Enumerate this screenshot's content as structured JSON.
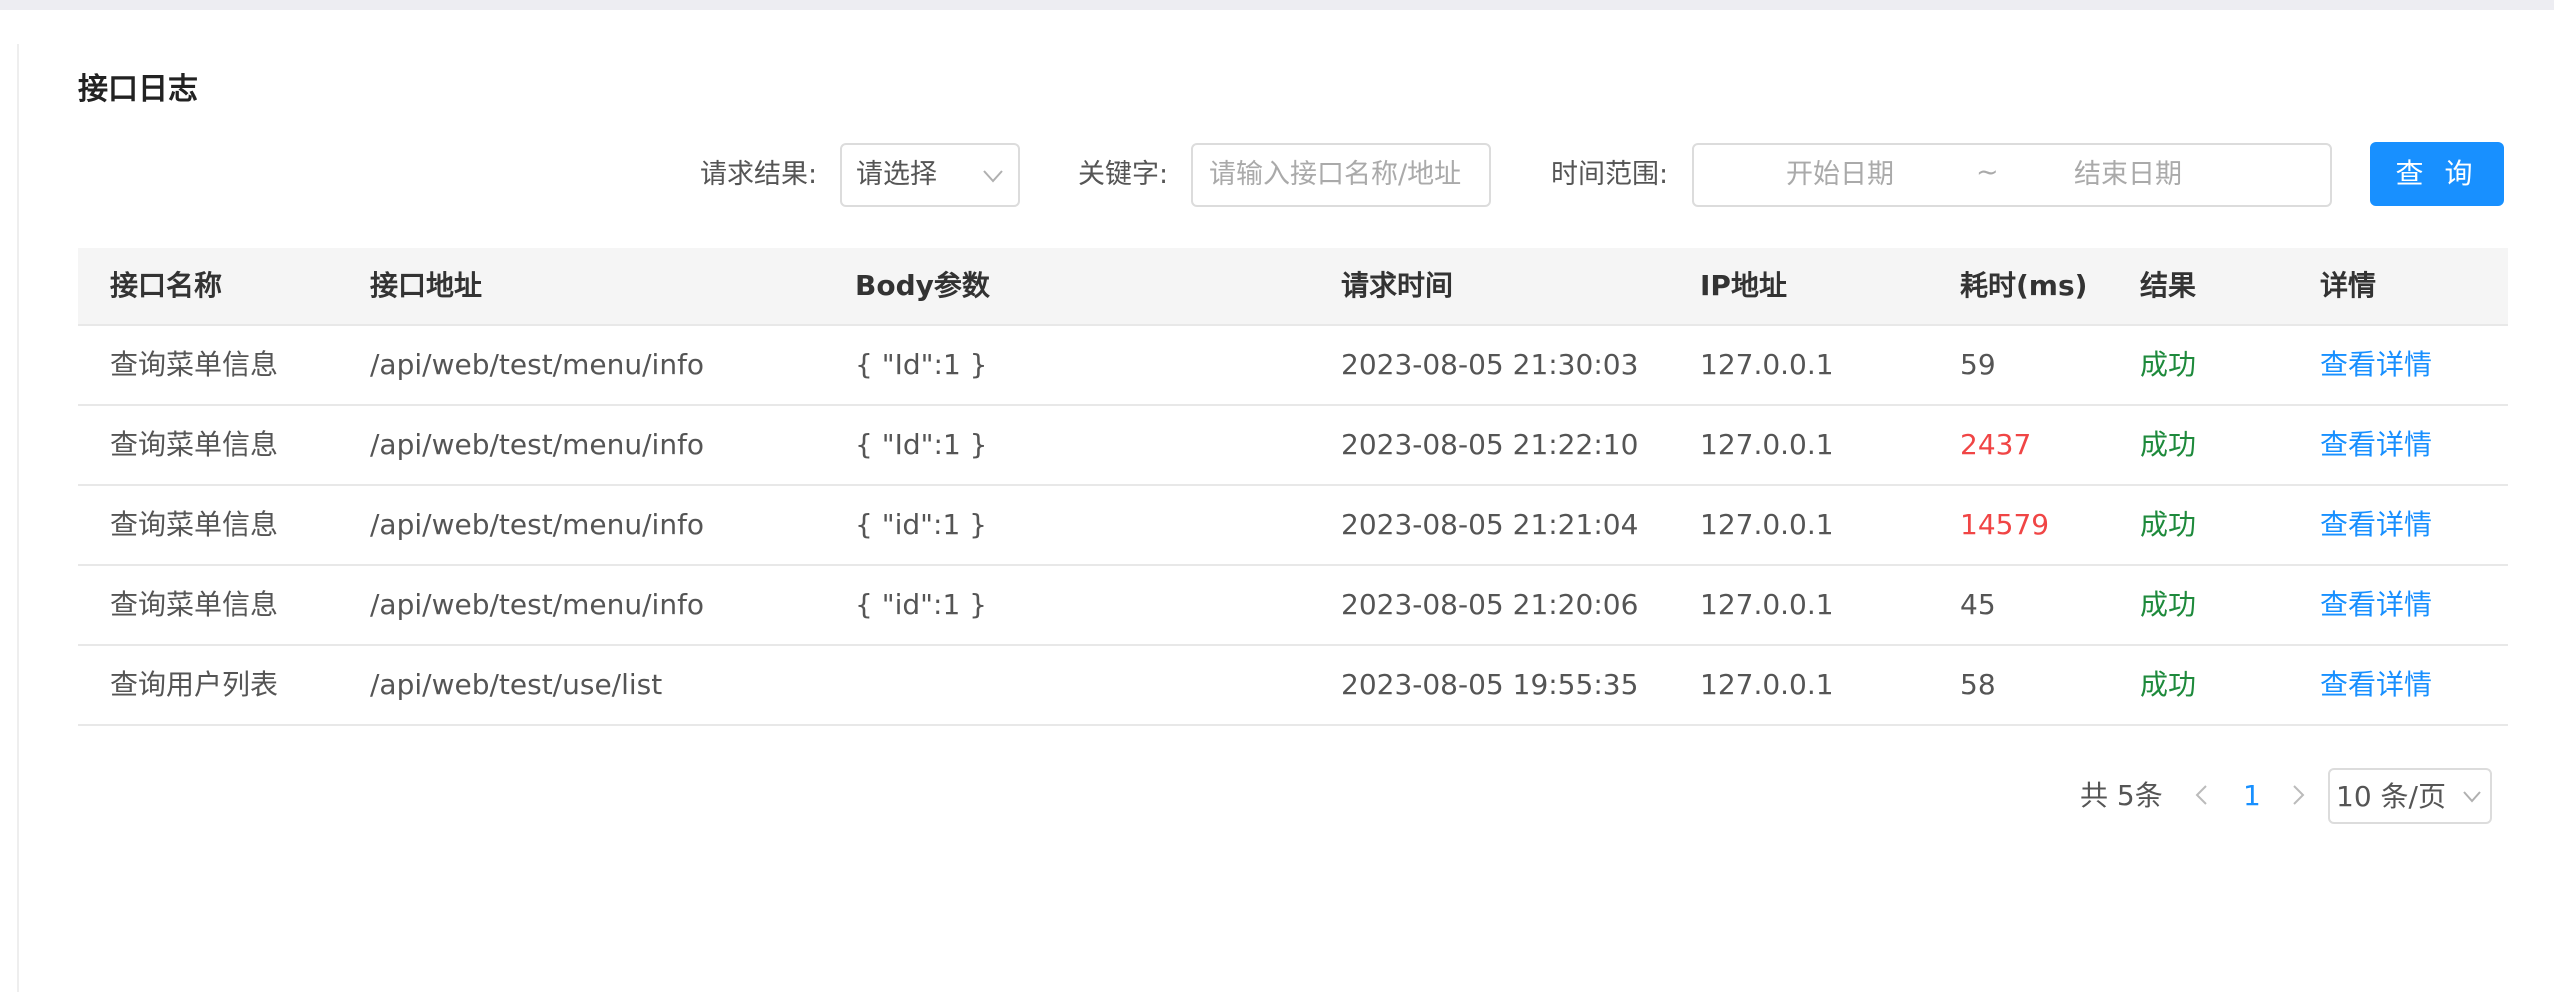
{
  "title": "接口日志",
  "filters": {
    "result_label": "请求结果:",
    "result_value": "请选择",
    "keyword_label": "关键字:",
    "keyword_placeholder": "请输入接口名称/地址",
    "time_label": "时间范围:",
    "start_placeholder": "开始日期",
    "range_sep": "~",
    "end_placeholder": "结束日期",
    "query_button": "查 询"
  },
  "table": {
    "columns": [
      "接口名称",
      "接口地址",
      "Body参数",
      "请求时间",
      "IP地址",
      "耗时(ms)",
      "结果",
      "详情"
    ],
    "rows": [
      {
        "name": "查询菜单信息",
        "path": "/api/web/test/menu/info",
        "body": "{ \"Id\":1 }",
        "time": "2023-08-05 21:30:03",
        "ip": "127.0.0.1",
        "cost": "59",
        "slow": false,
        "result": "成功",
        "detail": "查看详情"
      },
      {
        "name": "查询菜单信息",
        "path": "/api/web/test/menu/info",
        "body": "{ \"Id\":1 }",
        "time": "2023-08-05 21:22:10",
        "ip": "127.0.0.1",
        "cost": "2437",
        "slow": true,
        "result": "成功",
        "detail": "查看详情"
      },
      {
        "name": "查询菜单信息",
        "path": "/api/web/test/menu/info",
        "body": "{ \"id\":1 }",
        "time": "2023-08-05 21:21:04",
        "ip": "127.0.0.1",
        "cost": "14579",
        "slow": true,
        "result": "成功",
        "detail": "查看详情"
      },
      {
        "name": "查询菜单信息",
        "path": "/api/web/test/menu/info",
        "body": "{ \"id\":1 }",
        "time": "2023-08-05 21:20:06",
        "ip": "127.0.0.1",
        "cost": "45",
        "slow": false,
        "result": "成功",
        "detail": "查看详情"
      },
      {
        "name": "查询用户列表",
        "path": "/api/web/test/use/list",
        "body": "",
        "time": "2023-08-05 19:55:35",
        "ip": "127.0.0.1",
        "cost": "58",
        "slow": false,
        "result": "成功",
        "detail": "查看详情"
      }
    ]
  },
  "pagination": {
    "total": "共 5条",
    "current_page": "1",
    "page_size": "10 条/页"
  },
  "colors": {
    "primary": "#1890ff",
    "success": "#1e8a3c",
    "danger": "#f04545"
  },
  "icons": {
    "select_arrow": "chevron-down-icon",
    "prev": "chevron-left-icon",
    "next": "chevron-right-icon"
  }
}
